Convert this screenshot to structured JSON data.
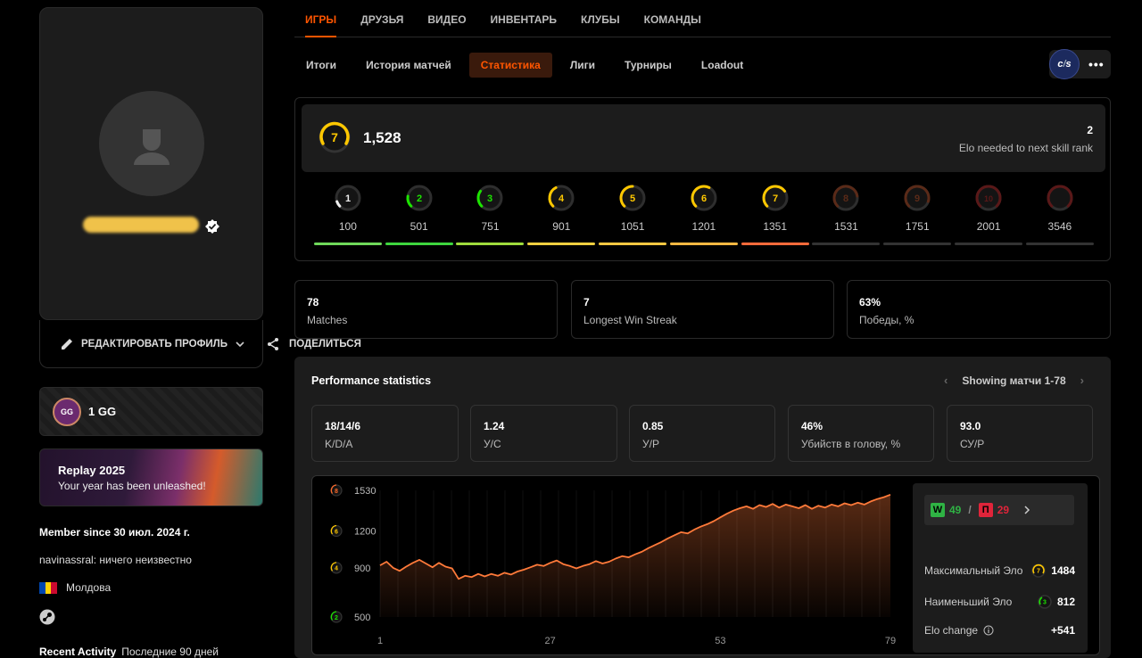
{
  "profile": {
    "edit_label": "РЕДАКТИРОВАТЬ ПРОФИЛЬ",
    "share_label": "ПОДЕЛИТЬСЯ",
    "club": {
      "logo_text": "GG",
      "name": "1 GG"
    },
    "replay": {
      "title": "Replay 2025",
      "subtitle": "Your year has been unleashed!"
    },
    "member_since": "Member since 30 июл. 2024 г.",
    "bio": "navinassral: ничего неизвестно",
    "country": "Молдова",
    "recent_activity_label": "Recent Activity",
    "recent_activity_period": "Последние 90 дней"
  },
  "nav": {
    "tabs": [
      {
        "label": "ИГРЫ",
        "active": true
      },
      {
        "label": "ДРУЗЬЯ"
      },
      {
        "label": "ВИДЕО"
      },
      {
        "label": "ИНВЕНТАРЬ"
      },
      {
        "label": "КЛУБЫ"
      },
      {
        "label": "КОМАНДЫ"
      }
    ],
    "subtabs": [
      {
        "label": "Итоги"
      },
      {
        "label": "История матчей"
      },
      {
        "label": "Статистика",
        "active": true
      },
      {
        "label": "Лиги"
      },
      {
        "label": "Турниры"
      },
      {
        "label": "Loadout"
      }
    ],
    "game_logo": "cs",
    "more": "•••"
  },
  "elo": {
    "level": "7",
    "value": "1,528",
    "needed": "2",
    "needed_label": "Elo needed to next skill rank",
    "levels": [
      {
        "num": "1",
        "value": "100",
        "color": "#eeeeee",
        "bar": "#6fd95a"
      },
      {
        "num": "2",
        "value": "501",
        "color": "#1ce400",
        "bar": "#3ed63e"
      },
      {
        "num": "3",
        "value": "751",
        "color": "#1ce400",
        "bar": "#9fdc3c"
      },
      {
        "num": "4",
        "value": "901",
        "color": "#ffc800",
        "bar": "#f0d040"
      },
      {
        "num": "5",
        "value": "1051",
        "color": "#ffc800",
        "bar": "#f5c842"
      },
      {
        "num": "6",
        "value": "1201",
        "color": "#ffc800",
        "bar": "#f5b842"
      },
      {
        "num": "7",
        "value": "1351",
        "color": "#ffc800",
        "bar": "#ff6a3a"
      },
      {
        "num": "8",
        "value": "1531",
        "color": "#5a2a18",
        "bar": "#333333"
      },
      {
        "num": "9",
        "value": "1751",
        "color": "#5a2a18",
        "bar": "#333333"
      },
      {
        "num": "10",
        "value": "2001",
        "color": "#5a1818",
        "bar": "#333333"
      },
      {
        "num": "",
        "value": "3546",
        "color": "#5a1818",
        "bar": "#333333"
      }
    ]
  },
  "summary": [
    {
      "value": "78",
      "label": "Matches"
    },
    {
      "value": "7",
      "label": "Longest Win Streak"
    },
    {
      "value": "63%",
      "label": "Победы, %"
    }
  ],
  "performance": {
    "title": "Performance statistics",
    "pager": "Showing матчи 1-78",
    "kpis": [
      {
        "value": "18/14/6",
        "label": "K/D/A"
      },
      {
        "value": "1.24",
        "label": "У/С"
      },
      {
        "value": "0.85",
        "label": "У/Р"
      },
      {
        "value": "46%",
        "label": "Убийств в голову, %"
      },
      {
        "value": "93.0",
        "label": "СУ/Р"
      }
    ],
    "wins": "49",
    "losses": "29",
    "win_letter": "W",
    "loss_letter": "П",
    "max_elo_label": "Максимальный Эло",
    "max_elo": "1484",
    "max_elo_level": "7",
    "min_elo_label": "Наименьший Эло",
    "min_elo": "812",
    "min_elo_level": "3",
    "elo_change_label": "Elo change",
    "elo_change": "+541"
  },
  "chart_data": {
    "type": "area",
    "title": "",
    "xlabel": "",
    "ylabel": "",
    "x_ticks": [
      "1",
      "27",
      "53",
      "79"
    ],
    "y_ticks": [
      {
        "label": "1530",
        "level": "8",
        "color": "#ff6a2a"
      },
      {
        "label": "1200",
        "level": "6",
        "color": "#ffc800"
      },
      {
        "label": "900",
        "level": "4",
        "color": "#ffc800"
      },
      {
        "label": "500",
        "level": "2",
        "color": "#1ce400"
      }
    ],
    "xlim": [
      1,
      79
    ],
    "ylim": [
      500,
      1530
    ],
    "line_color": "#ff7a3a",
    "series": [
      {
        "x": [
          1,
          2,
          3,
          4,
          5,
          6,
          7,
          8,
          9,
          10,
          11,
          12,
          13,
          14,
          15,
          16,
          17,
          18,
          19,
          20,
          21,
          22,
          23,
          24,
          25,
          26,
          27,
          28,
          29,
          30,
          31,
          32,
          33,
          34,
          35,
          36,
          37,
          38,
          39,
          40,
          41,
          42,
          43,
          44,
          45,
          46,
          47,
          48,
          49,
          50,
          51,
          52,
          53,
          54,
          55,
          56,
          57,
          58,
          59,
          60,
          61,
          62,
          63,
          64,
          65,
          66,
          67,
          68,
          69,
          70,
          71,
          72,
          73,
          74,
          75,
          76,
          77,
          78,
          79
        ],
        "values": [
          920,
          950,
          900,
          875,
          910,
          940,
          965,
          935,
          905,
          940,
          910,
          895,
          810,
          835,
          825,
          850,
          830,
          850,
          835,
          860,
          845,
          870,
          885,
          905,
          925,
          915,
          940,
          960,
          930,
          915,
          895,
          915,
          930,
          955,
          935,
          950,
          975,
          995,
          985,
          1010,
          1030,
          1060,
          1085,
          1110,
          1140,
          1165,
          1190,
          1180,
          1210,
          1235,
          1255,
          1280,
          1310,
          1340,
          1365,
          1385,
          1400,
          1380,
          1410,
          1395,
          1420,
          1390,
          1415,
          1400,
          1385,
          1410,
          1380,
          1405,
          1390,
          1415,
          1400,
          1425,
          1410,
          1430,
          1415,
          1440,
          1460,
          1475,
          1495
        ]
      }
    ]
  }
}
